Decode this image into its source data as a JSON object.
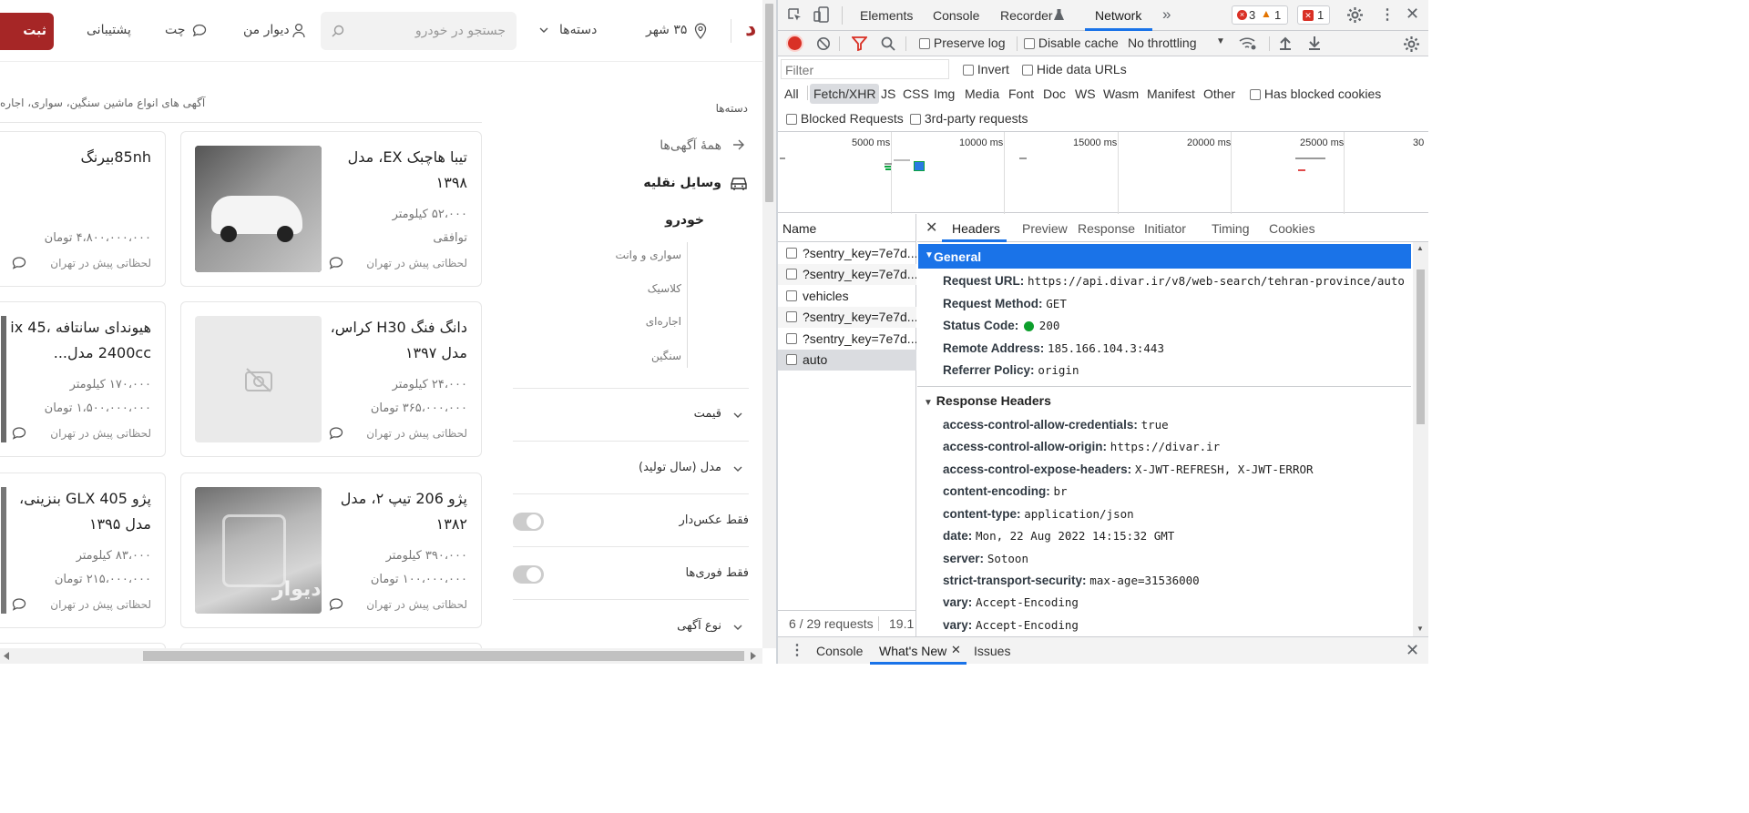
{
  "site": {
    "post_ad_button": "ثبت آگهی",
    "logo_fragment": "د",
    "city": "۳۵ شهر",
    "categories_label": "دسته‌ها",
    "search_placeholder": "جستجو در خودرو",
    "my_divar": "دیوار من",
    "chat": "چت",
    "support": "پشتیبانی",
    "description": "آگهی های انواع ماشین سنگین، سواری، اجاره",
    "sidebar": {
      "categories_title": "دسته‌ها",
      "all_ads": "همهٔ آگهی‌ها",
      "vehicles": "وسایل نقلیه",
      "car": "خودرو",
      "subcats": [
        "سواری و وانت",
        "کلاسیک",
        "اجاره‌ای",
        "سنگین"
      ]
    },
    "filters": {
      "price": "قیمت",
      "model": "مدل (سال تولید)",
      "photo_only": "فقط عکس‌دار",
      "urgent_only": "فقط فوری‌ها",
      "ad_type": "نوع آگهی"
    },
    "cards": [
      {
        "title": "تیبا هاچبک EX، مدل ۱۳۹۸",
        "line1": "۵۲،۰۰۰ کیلومتر",
        "line2": "توافقی",
        "footer": "لحظاتی پیش در تهران"
      },
      {
        "title": "85nhبیرنگ",
        "line1": "",
        "line2": "۴،۸۰۰،۰۰۰،۰۰۰ تومان",
        "footer": "لحظاتی پیش در تهران"
      },
      {
        "title": "دانگ فنگ H30 کراس، مدل ۱۳۹۷",
        "line1": "۲۴،۰۰۰ کیلومتر",
        "line2": "۳۶۵،۰۰۰،۰۰۰ تومان",
        "footer": "لحظاتی پیش در تهران"
      },
      {
        "title": "هیوندای سانتافه ix 45، 2400cc مدل...",
        "line1": "۱۷۰،۰۰۰ کیلومتر",
        "line2": "۱،۵۰۰،۰۰۰،۰۰۰ تومان",
        "footer": "لحظاتی پیش در تهران"
      },
      {
        "title": "پژو 206 تیپ ۲، مدل ۱۳۸۲",
        "line1": "۳۹۰،۰۰۰ کیلومتر",
        "line2": "۱۰۰،۰۰۰،۰۰۰ تومان",
        "footer": "لحظاتی پیش در تهران"
      },
      {
        "title": "پژو GLX 405 بنزینی، مدل ۱۳۹۵",
        "line1": "۸۳،۰۰۰ کیلومتر",
        "line2": "۲۱۵،۰۰۰،۰۰۰ تومان",
        "footer": "لحظاتی پیش در تهران"
      }
    ],
    "watermark": "دیوار"
  },
  "devtools": {
    "tabs": [
      "Elements",
      "Console",
      "Recorder",
      "Network"
    ],
    "active_tab": "Network",
    "errors": "3",
    "warnings": "1",
    "issues": "1",
    "preserve_log": "Preserve log",
    "disable_cache": "Disable cache",
    "throttling": "No throttling",
    "filter_placeholder": "Filter",
    "invert": "Invert",
    "hide_data_urls": "Hide data URLs",
    "type_filters": [
      "All",
      "Fetch/XHR",
      "JS",
      "CSS",
      "Img",
      "Media",
      "Font",
      "Doc",
      "WS",
      "Wasm",
      "Manifest",
      "Other"
    ],
    "active_type": "Fetch/XHR",
    "has_blocked_cookies": "Has blocked cookies",
    "blocked_requests": "Blocked Requests",
    "third_party": "3rd-party requests",
    "timeline_ticks": [
      "5000 ms",
      "10000 ms",
      "15000 ms",
      "20000 ms",
      "25000 ms",
      "30"
    ],
    "name_header": "Name",
    "requests": [
      "?sentry_key=7e7d...",
      "?sentry_key=7e7d...",
      "vehicles",
      "?sentry_key=7e7d...",
      "?sentry_key=7e7d...",
      "auto"
    ],
    "detail_tabs": [
      "Headers",
      "Preview",
      "Response",
      "Initiator",
      "Timing",
      "Cookies"
    ],
    "active_detail_tab": "Headers",
    "general_title": "General",
    "general": [
      {
        "k": "Request URL:",
        "v": "https://api.divar.ir/v8/web-search/tehran-province/auto"
      },
      {
        "k": "Request Method:",
        "v": "GET"
      },
      {
        "k": "Status Code:",
        "v": "200"
      },
      {
        "k": "Remote Address:",
        "v": "185.166.104.3:443"
      },
      {
        "k": "Referrer Policy:",
        "v": "origin"
      }
    ],
    "response_headers_title": "Response Headers",
    "response_headers": [
      {
        "k": "access-control-allow-credentials:",
        "v": "true"
      },
      {
        "k": "access-control-allow-origin:",
        "v": "https://divar.ir"
      },
      {
        "k": "access-control-expose-headers:",
        "v": "X-JWT-REFRESH, X-JWT-ERROR"
      },
      {
        "k": "content-encoding:",
        "v": "br"
      },
      {
        "k": "content-type:",
        "v": "application/json"
      },
      {
        "k": "date:",
        "v": "Mon, 22 Aug 2022 14:15:32 GMT"
      },
      {
        "k": "server:",
        "v": "Sotoon"
      },
      {
        "k": "strict-transport-security:",
        "v": "max-age=31536000"
      },
      {
        "k": "vary:",
        "v": "Accept-Encoding"
      },
      {
        "k": "vary:",
        "v": "Accept-Encoding"
      }
    ],
    "status_requests": "6 / 29 requests",
    "status_size": "19.1",
    "drawer_tabs": [
      "Console",
      "What's New",
      "Issues"
    ],
    "active_drawer": "What's New",
    "colors": {
      "accent": "#1a73e8",
      "record": "#d93025",
      "general_bg": "#1a73e8",
      "ok": "#0d9f2c",
      "brand": "#a62626"
    }
  }
}
